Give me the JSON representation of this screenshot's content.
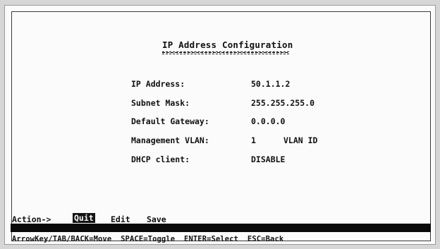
{
  "screen": {
    "title": "IP Address Configuration",
    "fields": [
      {
        "label": "IP Address:",
        "value": "50.1.1.2",
        "extra": ""
      },
      {
        "label": "Subnet Mask:",
        "value": "255.255.255.0",
        "extra": ""
      },
      {
        "label": "Default Gateway:",
        "value": "0.0.0.0",
        "extra": ""
      },
      {
        "label": "Management VLAN:",
        "value": "1",
        "extra": "VLAN ID"
      },
      {
        "label": "DHCP client:",
        "value": "DISABLE",
        "extra": ""
      }
    ]
  },
  "action_bar": {
    "prefix": "Action->",
    "items": [
      "Quit",
      "Edit",
      "Save"
    ],
    "selected": "Quit"
  },
  "help": {
    "text": "ArrowKey/TAB/BACK=Move  SPACE=Toggle  ENTER=Select  ESC=Back"
  },
  "colors": {
    "background": "#fbfbfb",
    "text": "#111111",
    "highlight_bar": "#0a0a0a"
  }
}
